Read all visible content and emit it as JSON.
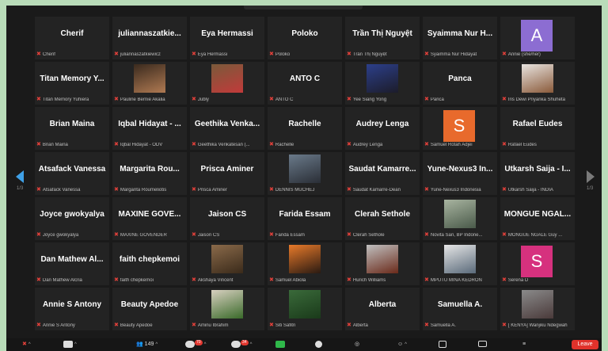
{
  "pager": {
    "left": "1/3",
    "right": "1/3"
  },
  "participants": [
    {
      "name": "Cherif",
      "label": "Cherif",
      "kind": "name"
    },
    {
      "name": "juliannaszatkie...",
      "label": "juliannaszatkiewicz",
      "kind": "name"
    },
    {
      "name": "Eya Hermassi",
      "label": "Eya Hermassi",
      "kind": "name"
    },
    {
      "name": "Poloko",
      "label": "Poloko",
      "kind": "name"
    },
    {
      "name": "Trần Thị Nguyệt",
      "label": "Trần Thị Nguyệt",
      "kind": "name"
    },
    {
      "name": "Syaimma Nur H...",
      "label": "Syaimma Nur Hidayat",
      "kind": "name"
    },
    {
      "name": "",
      "label": "Annie (she/her)",
      "kind": "avatar",
      "letter": "A",
      "color": "#8c6dd2"
    },
    {
      "name": "Titan Memory Y...",
      "label": "Titan Memory Yuhiera",
      "kind": "name"
    },
    {
      "name": "",
      "label": "Pauline Bernie Akalia",
      "kind": "photo",
      "colors": [
        "#3a2a1e",
        "#b07a52"
      ]
    },
    {
      "name": "",
      "label": "Jubly",
      "kind": "photo",
      "colors": [
        "#7a5a3a",
        "#c23a3a"
      ]
    },
    {
      "name": "ANTO C",
      "label": "ANTO C",
      "kind": "name"
    },
    {
      "name": "",
      "label": "Yee Siang Yong",
      "kind": "photo",
      "colors": [
        "#2c3f8a",
        "#1c1c2a"
      ]
    },
    {
      "name": "Panca",
      "label": "Panca",
      "kind": "name"
    },
    {
      "name": "",
      "label": "Iris Dewi Priyanka Shuheta",
      "kind": "photo",
      "colors": [
        "#e8e4e0",
        "#8a5a3a"
      ]
    },
    {
      "name": "Brian Maina",
      "label": "Brian Maina",
      "kind": "name"
    },
    {
      "name": "Iqbal Hidayat - ...",
      "label": "Iqbal Hidayat - ODV",
      "kind": "name"
    },
    {
      "name": "Geethika Venka...",
      "label": "Geethika Venkatesan (...",
      "kind": "name"
    },
    {
      "name": "Rachelle",
      "label": "Rachelle",
      "kind": "name"
    },
    {
      "name": "Audrey Lenga",
      "label": "Audrey Lenga",
      "kind": "name"
    },
    {
      "name": "",
      "label": "Samuel Rotah Adjei",
      "kind": "avatar",
      "letter": "S",
      "color": "#e86a2c"
    },
    {
      "name": "Rafael Eudes",
      "label": "Rafael Eudes",
      "kind": "name"
    },
    {
      "name": "Atsafack Vanessa",
      "label": "Atsafack Vanessa",
      "kind": "name"
    },
    {
      "name": "Margarita Rou...",
      "label": "Margarita Roumeliotis",
      "kind": "name"
    },
    {
      "name": "Prisca Aminer",
      "label": "Prisca Aminer",
      "kind": "name"
    },
    {
      "name": "",
      "label": "DENNIS MUCHEJ",
      "kind": "photo",
      "colors": [
        "#6a7a8a",
        "#2a2e36"
      ]
    },
    {
      "name": "Saudat Kamarre...",
      "label": "Saudat Kamarre-Dean",
      "kind": "name"
    },
    {
      "name": "Yune-Nexus3 In...",
      "label": "Yune-Nexus3 Indonesia",
      "kind": "name"
    },
    {
      "name": "Utkarsh Saija - I...",
      "label": "Utkarsh Saija - INDIA",
      "kind": "name"
    },
    {
      "name": "Joyce gwokyalya",
      "label": "Joyce gwokyalya",
      "kind": "name"
    },
    {
      "name": "MAXINE GOVE...",
      "label": "MAXINE GOVENDER",
      "kind": "name"
    },
    {
      "name": "Jaison CS",
      "label": "Jaison CS",
      "kind": "name"
    },
    {
      "name": "Farida Essam",
      "label": "Farida Essam",
      "kind": "name"
    },
    {
      "name": "Clerah Sethole",
      "label": "Clerah Sethole",
      "kind": "name"
    },
    {
      "name": "",
      "label": "Novita Sari, BP Indone...",
      "kind": "photo",
      "colors": [
        "#a8b4a0",
        "#4a5a4a"
      ]
    },
    {
      "name": "MONGUE NGAL...",
      "label": "MONGUE NGALE Guy ...",
      "kind": "name"
    },
    {
      "name": "Dan Mathew Al...",
      "label": "Dan Mathew Alcria",
      "kind": "name"
    },
    {
      "name": "faith chepkemoi",
      "label": "faith chepkemoi",
      "kind": "name"
    },
    {
      "name": "",
      "label": "Akshaya Vincent",
      "kind": "photo",
      "colors": [
        "#8a6a4a",
        "#3a2a1a"
      ]
    },
    {
      "name": "",
      "label": "Samuel Abiola",
      "kind": "photo",
      "colors": [
        "#e87a2a",
        "#2a1a12"
      ]
    },
    {
      "name": "",
      "label": "Hurich Williams",
      "kind": "photo",
      "colors": [
        "#c0c0c0",
        "#6a2a1a"
      ]
    },
    {
      "name": "",
      "label": "MPUTU MINA KEDRON",
      "kind": "photo",
      "colors": [
        "#e6e6e6",
        "#5a6a7a"
      ]
    },
    {
      "name": "",
      "label": "Serena D",
      "kind": "avatar",
      "letter": "S",
      "color": "#d6317e"
    },
    {
      "name": "Annie S Antony",
      "label": "Annie S Antony",
      "kind": "name"
    },
    {
      "name": "Beauty Apedoe",
      "label": "Beauty Apedoe",
      "kind": "name"
    },
    {
      "name": "",
      "label": "Aminu Ibrahim",
      "kind": "photo",
      "colors": [
        "#d8d0c0",
        "#3a6a2a"
      ]
    },
    {
      "name": "",
      "label": "Siti Safitri",
      "kind": "photo",
      "colors": [
        "#3a6a3a",
        "#1a3a1a"
      ]
    },
    {
      "name": "Alberta",
      "label": "Alberta",
      "kind": "name"
    },
    {
      "name": "Samuella A.",
      "label": "Samuella A.",
      "kind": "name"
    },
    {
      "name": "",
      "label": "[ KENYA] Wanjiku Ndegwah",
      "kind": "photo",
      "colors": [
        "#8a8a8a",
        "#4a3a3a"
      ]
    }
  ],
  "toolbar": {
    "participants_count": "149",
    "chat_badge": "70",
    "reactions_badge": "34",
    "leave_label": "Leave"
  }
}
